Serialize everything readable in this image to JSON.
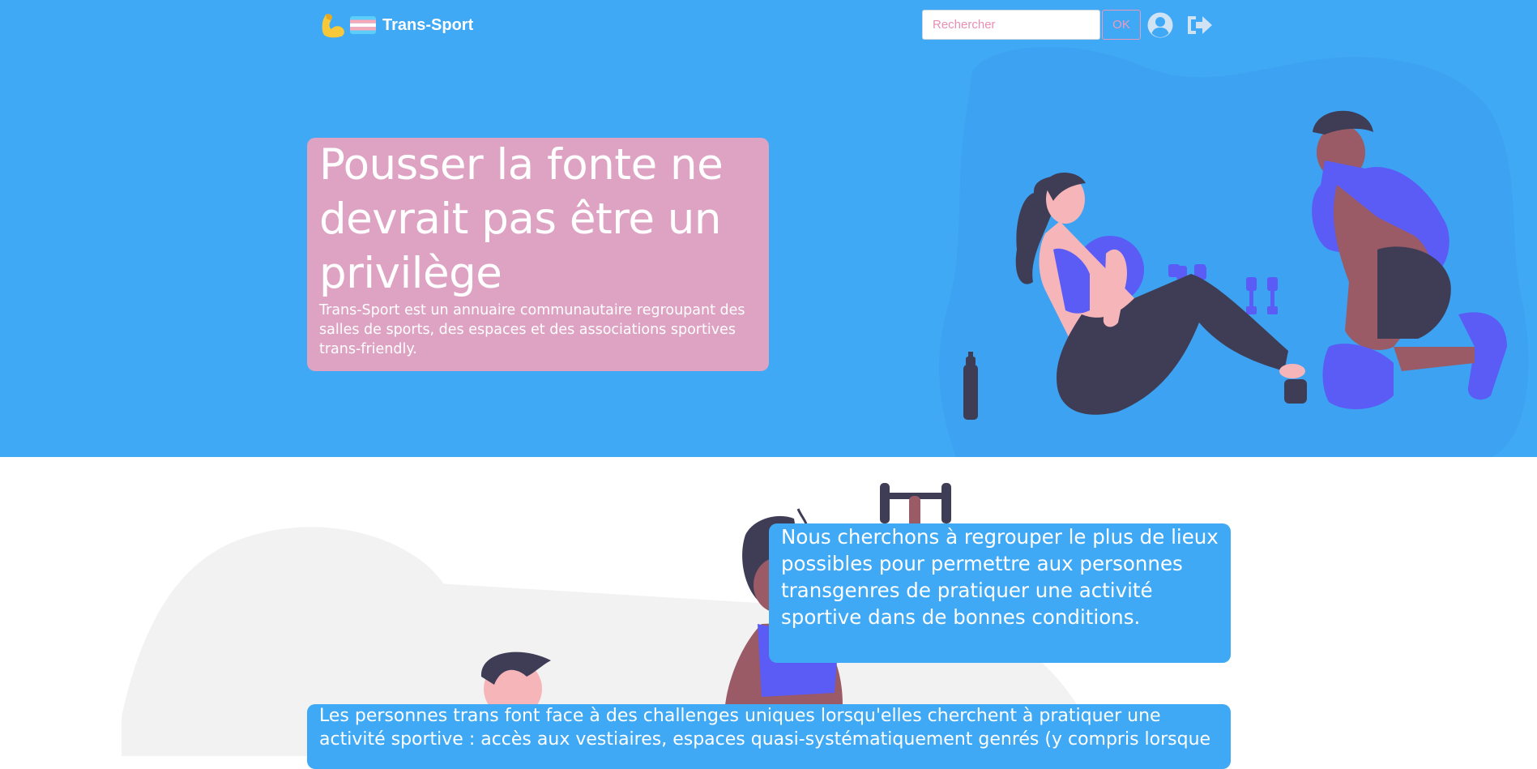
{
  "navbar": {
    "brand_name": "Trans-Sport",
    "search_placeholder": "Rechercher",
    "search_button": "OK",
    "icons": [
      "flexed-biceps-emoji",
      "transgender-flag-emoji",
      "user-circle-icon",
      "sign-out-icon"
    ]
  },
  "hero": {
    "title": "Pousser la fonte ne devrait pas être un privilège",
    "subtitle": "Trans-Sport est un annuaire communautaire regroupant des salles de sports, des espaces et des associations sportives trans-friendly."
  },
  "mission": {
    "text": "Nous cherchons à regrouper le plus de lieux possibles pour permettre aux personnes transgenres de pratiquer une activité sportive dans de bonnes conditions."
  },
  "challenges": {
    "text": "Les personnes trans font face à des challenges uniques lorsqu'elles cherchent à pratiquer une activité sportive : accès aux vestiaires, espaces quasi-systématiquement genrés (y compris lorsque"
  },
  "colors": {
    "primary_blue": "#3fa9f5",
    "pink": "#dea3c3",
    "white": "#ffffff",
    "illustration_purple": "#5b5cf6",
    "illustration_dark": "#3f3d56"
  }
}
